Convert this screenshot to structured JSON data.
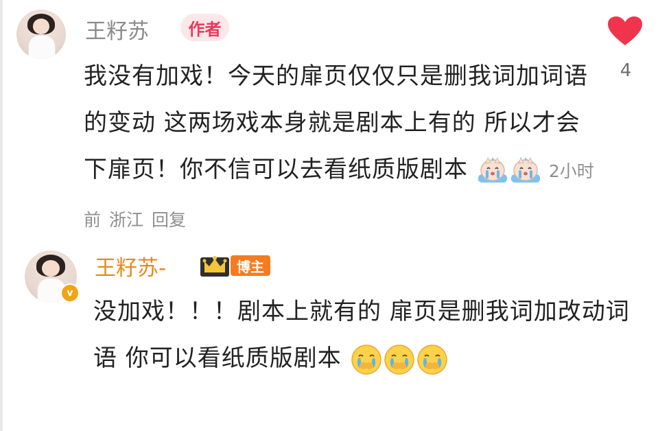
{
  "comment": {
    "author": "王籽苏",
    "author_badge": "作者",
    "like_count": "4",
    "text": "我没有加戏！今天的扉页仅仅只是删我词加词语的变动 这两场戏本身就是剧本上有的 所以才会下扉页！你不信可以去看纸质版剧本",
    "text_emojis": [
      "crying-cat-emoji",
      "crying-cat-emoji"
    ],
    "time": "2小时前",
    "location": "浙江",
    "reply_label": "回复",
    "heart_color": "#f0344d"
  },
  "reply": {
    "author": "王籽苏-",
    "crown_icon": "crown-icon",
    "badge": "博主",
    "verified_icon": "verified-v-icon",
    "text": "没加戏！！！剧本上就有的 扉页是删我词加改动词语 你可以看纸质版剧本",
    "text_emojis": [
      "crying-face-emoji",
      "crying-face-emoji",
      "crying-face-emoji"
    ],
    "name_color": "#e58a1f"
  }
}
